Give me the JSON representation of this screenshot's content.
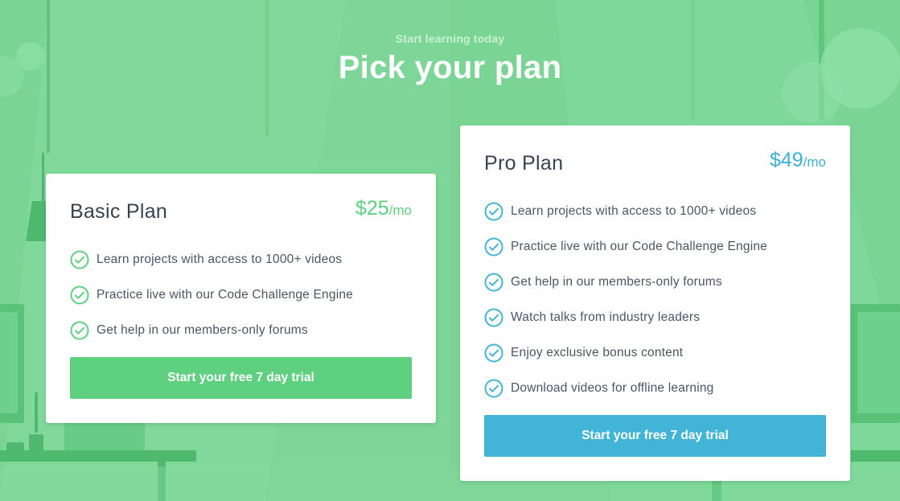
{
  "hero": {
    "eyebrow": "Start learning today",
    "title": "Pick your plan"
  },
  "colors": {
    "background": "#7ad595",
    "basic_accent": "#5fcf80",
    "pro_accent": "#42b4d6",
    "text_dark": "#384350"
  },
  "plans": [
    {
      "name": "Basic Plan",
      "price": "$25",
      "period": "/mo",
      "check_icon": "check-circle-icon",
      "features": [
        "Learn projects with access to 1000+ videos",
        "Practice live with our Code Challenge Engine",
        "Get help in our members-only forums"
      ],
      "cta": "Start your free 7 day trial"
    },
    {
      "name": "Pro Plan",
      "price": "$49",
      "period": "/mo",
      "check_icon": "check-circle-icon",
      "features": [
        "Learn projects with access to 1000+ videos",
        "Practice live with our Code Challenge Engine",
        "Get help in our members-only forums",
        "Watch talks from industry leaders",
        "Enjoy exclusive bonus content",
        "Download videos for offline learning"
      ],
      "cta": "Start your free 7 day trial"
    }
  ]
}
